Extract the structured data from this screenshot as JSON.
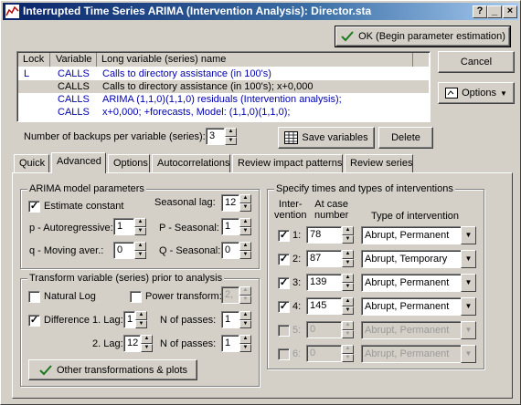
{
  "window": {
    "title": "Interrupted Time Series ARIMA (Intervention Analysis): Director.sta",
    "help_btn": "?",
    "min_btn": "_",
    "close_btn": "×"
  },
  "buttons": {
    "ok": "OK (Begin parameter estimation)",
    "cancel": "Cancel",
    "options": "Options",
    "save_variables": "Save variables",
    "delete": "Delete",
    "other_transformations": "Other transformations & plots"
  },
  "variables_table": {
    "headers": [
      "Lock",
      "Variable",
      "Long variable (series) name"
    ],
    "rows": [
      {
        "lock": "L",
        "variable": "CALLS",
        "name": "Calls to directory assistance (in 100's)"
      },
      {
        "lock": "",
        "variable": "CALLS",
        "name": "Calls to directory assistance (in 100's); x+0,000"
      },
      {
        "lock": "",
        "variable": "CALLS",
        "name": "ARIMA (1,1,0)(1,1,0) residuals (Intervention analysis);"
      },
      {
        "lock": "",
        "variable": "CALLS",
        "name": "x+0,000; +forecasts, Model: (1,1,0)(1,1,0);"
      }
    ]
  },
  "backups": {
    "label": "Number of backups per variable (series):",
    "value": "3"
  },
  "tabs": [
    "Quick",
    "Advanced",
    "Options",
    "Autocorrelations",
    "Review impact patterns",
    "Review series"
  ],
  "arima": {
    "group_title": "ARIMA model parameters",
    "estimate_constant_label": "Estimate constant",
    "seasonal_lag_label": "Seasonal lag:",
    "seasonal_lag": "12",
    "p_label": "p - Autoregressive:",
    "p": "1",
    "P_label": "P - Seasonal:",
    "P": "1",
    "q_label": "q - Moving aver.:",
    "q": "0",
    "Q_label": "Q - Seasonal:",
    "Q": "0"
  },
  "transform": {
    "group_title": "Transform variable (series) prior to analysis",
    "natural_log_label": "Natural Log",
    "power_transform_label": "Power transform:",
    "power_value": "2,",
    "difference_label": "Difference",
    "lag1_label": "1. Lag:",
    "lag1": "1",
    "passes1_label": "N of passes:",
    "passes1": "1",
    "lag2_label": "2. Lag:",
    "lag2": "12",
    "passes2_label": "N of passes:",
    "passes2": "1"
  },
  "interventions": {
    "group_title": "Specify times and types of interventions",
    "col_intervention": "Inter-\nvention",
    "col_case": "At case\nnumber",
    "col_type": "Type of intervention",
    "rows": [
      {
        "num": "1:",
        "case": "78",
        "type": "Abrupt, Permanent"
      },
      {
        "num": "2:",
        "case": "87",
        "type": "Abrupt, Temporary"
      },
      {
        "num": "3:",
        "case": "139",
        "type": "Abrupt, Permanent"
      },
      {
        "num": "4:",
        "case": "145",
        "type": "Abrupt, Permanent"
      },
      {
        "num": "5:",
        "case": "0",
        "type": "Abrupt, Permanent"
      },
      {
        "num": "6:",
        "case": "0",
        "type": "Abrupt, Permanent"
      }
    ]
  }
}
